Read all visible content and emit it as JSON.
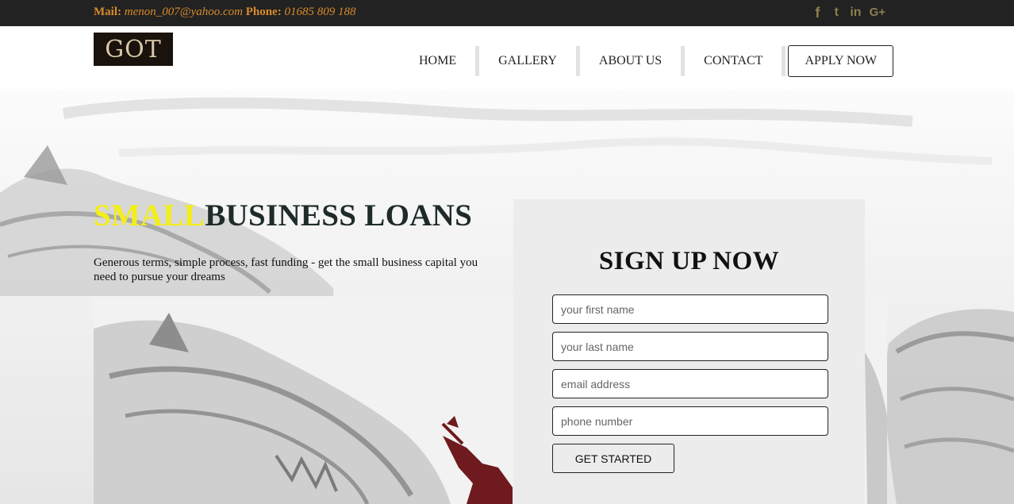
{
  "topbar": {
    "mail_label": "Mail:",
    "mail_value": "menon_007@yahoo.com",
    "phone_label": "Phone:",
    "phone_value": "01685 809 188",
    "social": {
      "facebook": "f",
      "twitter": "t",
      "linkedin": "in",
      "googleplus": "G+"
    },
    "social_icons": [
      "facebook-icon",
      "twitter-icon",
      "linkedin-icon",
      "google-plus-icon"
    ]
  },
  "header": {
    "logo_text": "GOT",
    "nav": {
      "home": "HOME",
      "gallery": "GALLERY",
      "about": "ABOUT US",
      "contact": "CONTACT",
      "apply": "APPLY NOW"
    }
  },
  "hero": {
    "title_highlight": "SMALL",
    "title_rest": "BUSINESS LOANS",
    "subtitle": "Generous terms, simple process, fast funding - get the small business capital you need to pursue your dreams"
  },
  "signup": {
    "title": "SIGN UP NOW",
    "first_name_placeholder": "your first name",
    "last_name_placeholder": "your last name",
    "email_placeholder": "email address",
    "phone_placeholder": "phone number",
    "submit_label": "GET STARTED"
  },
  "colors": {
    "topbar_bg": "#222222",
    "contact_text": "#d98a2b",
    "social_icon": "#8e7f4e",
    "title_highlight": "#f4ee18",
    "card_bg": "#ececec"
  }
}
